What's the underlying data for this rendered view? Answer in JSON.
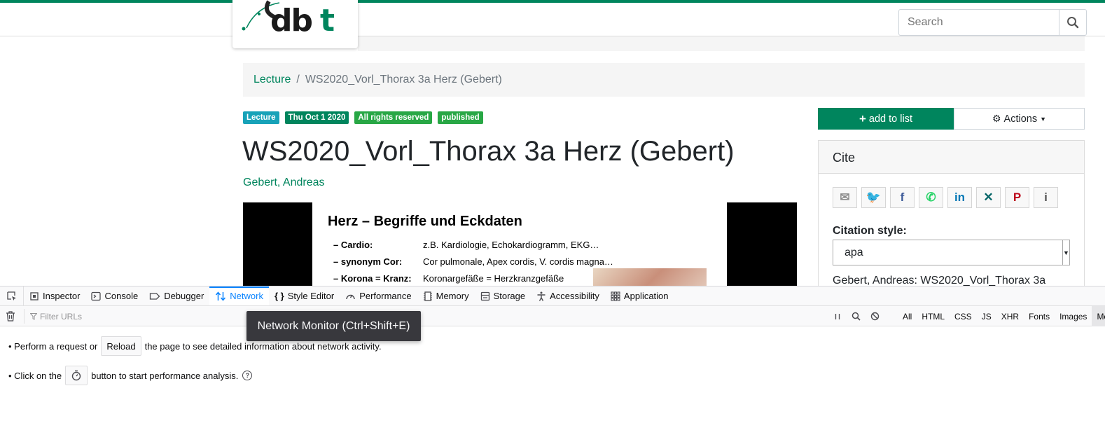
{
  "header": {
    "logo_text": "dbt",
    "search_placeholder": "Search"
  },
  "breadcrumb": {
    "items": [
      {
        "label": "Lecture"
      },
      {
        "label": "WS2020_Vorl_Thorax 3a Herz (Gebert)"
      }
    ],
    "separator": "/"
  },
  "badges": [
    {
      "label": "Lecture",
      "color": "#17a2b8"
    },
    {
      "label": "Thu Oct 1 2020",
      "color": "#00855d"
    },
    {
      "label": "All rights reserved",
      "color": "#28a745"
    },
    {
      "label": "published",
      "color": "#28a745"
    }
  ],
  "document": {
    "title": "WS2020_Vorl_Thorax 3a Herz (Gebert)",
    "author": "Gebert, Andreas"
  },
  "slide": {
    "title": "Herz – Begriffe und Eckdaten",
    "rows": [
      {
        "key": "– Cardio:",
        "value": "z.B. Kardiologie, Echokardiogramm, EKG…"
      },
      {
        "key": "– synonym Cor:",
        "value": "Cor pulmonale, Apex cordis, V. cordis magna…"
      },
      {
        "key": "– Korona = Kranz:",
        "value": "Koronargefäße = Herzkranzgefäße"
      }
    ]
  },
  "sidebar": {
    "add_to_list": "add to list",
    "actions": "Actions",
    "cite": {
      "header": "Cite",
      "share_buttons": [
        {
          "icon": "email-icon",
          "glyph": "✉",
          "color": "#8a8a8a"
        },
        {
          "icon": "twitter-icon",
          "glyph": "🐦",
          "color": "#1da1f2"
        },
        {
          "icon": "facebook-icon",
          "glyph": "f",
          "color": "#3b5998"
        },
        {
          "icon": "whatsapp-icon",
          "glyph": "✆",
          "color": "#25d366"
        },
        {
          "icon": "linkedin-icon",
          "glyph": "in",
          "color": "#0077b5"
        },
        {
          "icon": "xing-icon",
          "glyph": "✕",
          "color": "#026466"
        },
        {
          "icon": "pinterest-icon",
          "glyph": "P",
          "color": "#bd081c"
        },
        {
          "icon": "info-icon",
          "glyph": "i",
          "color": "#555555"
        }
      ],
      "style_label": "Citation style:",
      "style_value": "apa",
      "citation_text": "Gebert, Andreas: WS2020_Vorl_Thorax 3a"
    }
  },
  "devtools": {
    "tabs": [
      {
        "label": "Inspector",
        "icon": "inspector-icon"
      },
      {
        "label": "Console",
        "icon": "console-icon"
      },
      {
        "label": "Debugger",
        "icon": "debugger-icon"
      },
      {
        "label": "Network",
        "icon": "network-icon",
        "active": true
      },
      {
        "label": "Style Editor",
        "icon": "style-editor-icon"
      },
      {
        "label": "Performance",
        "icon": "performance-icon"
      },
      {
        "label": "Memory",
        "icon": "memory-icon"
      },
      {
        "label": "Storage",
        "icon": "storage-icon"
      },
      {
        "label": "Accessibility",
        "icon": "accessibility-icon"
      },
      {
        "label": "Application",
        "icon": "application-icon"
      }
    ],
    "filter_placeholder": "Filter URLs",
    "type_filters": [
      "All",
      "HTML",
      "CSS",
      "JS",
      "XHR",
      "Fonts",
      "Images",
      "Med"
    ],
    "selected_type": "Med",
    "tooltip": "Network Monitor (Ctrl+Shift+E)",
    "message1": {
      "prefix": "• Perform a request or",
      "button": "Reload",
      "suffix": "the page to see detailed information about network activity."
    },
    "message2": {
      "prefix": "• Click on the",
      "suffix": "button to start performance analysis."
    }
  }
}
